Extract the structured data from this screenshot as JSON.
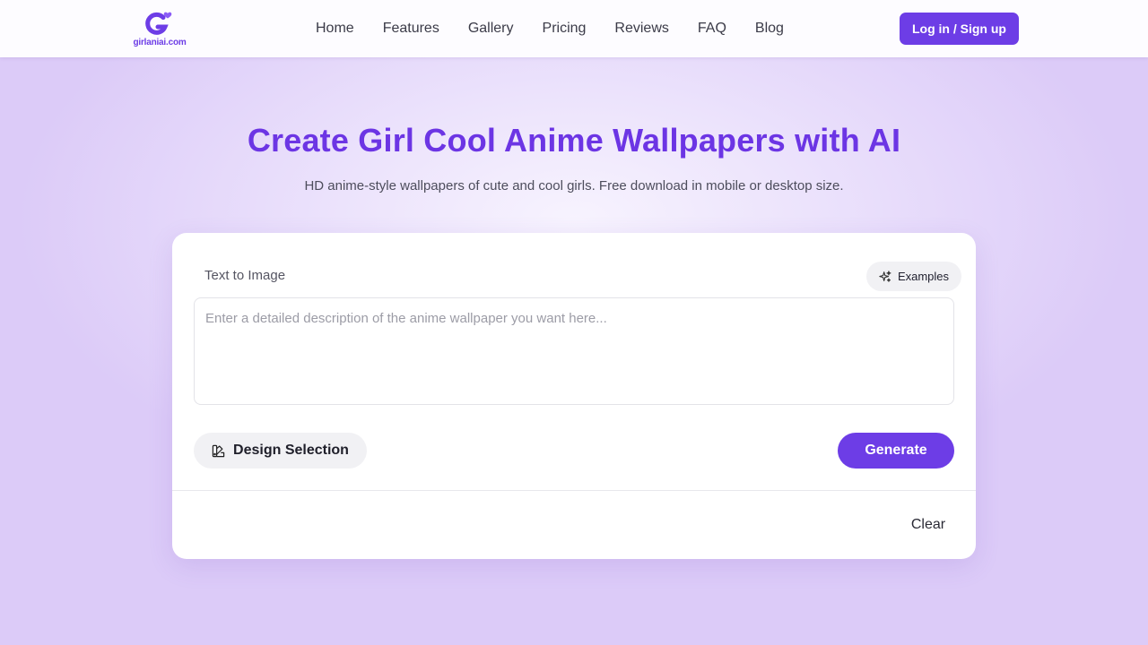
{
  "header": {
    "logo_text": "girlaniai.com",
    "nav": [
      {
        "label": "Home",
        "name": "nav-home"
      },
      {
        "label": "Features",
        "name": "nav-features"
      },
      {
        "label": "Gallery",
        "name": "nav-gallery"
      },
      {
        "label": "Pricing",
        "name": "nav-pricing"
      },
      {
        "label": "Reviews",
        "name": "nav-reviews"
      },
      {
        "label": "FAQ",
        "name": "nav-faq"
      },
      {
        "label": "Blog",
        "name": "nav-blog"
      }
    ],
    "auth_label": "Log in / Sign up"
  },
  "hero": {
    "title": "Create Girl Cool Anime Wallpapers with AI",
    "subtitle": "HD anime-style wallpapers of cute and cool girls. Free download in mobile or desktop size."
  },
  "generator": {
    "mode_label": "Text to Image",
    "examples_label": "Examples",
    "examples_icon": "sparkles-icon",
    "prompt_placeholder": "Enter a detailed description of the anime wallpaper you want here...",
    "prompt_value": "",
    "design_label": "Design Selection",
    "design_icon": "design-palette-icon",
    "generate_label": "Generate",
    "clear_label": "Clear"
  },
  "colors": {
    "brand": "#6d3de6",
    "title": "#6c35e4",
    "background": "#e6dafb"
  }
}
